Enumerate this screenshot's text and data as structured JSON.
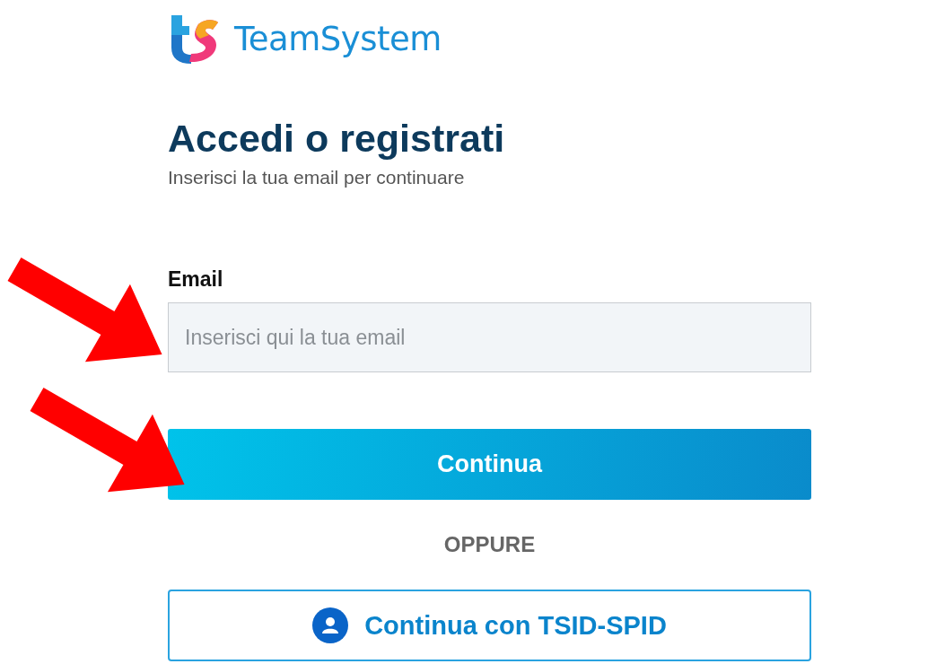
{
  "logo": {
    "text": "TeamSystem"
  },
  "title": "Accedi o registrati",
  "subtitle": "Inserisci la tua email per continuare",
  "email": {
    "label": "Email",
    "placeholder": "Inserisci qui la tua email"
  },
  "continue_button": "Continua",
  "separator": "OPPURE",
  "spid_button": "Continua con TSID-SPID"
}
